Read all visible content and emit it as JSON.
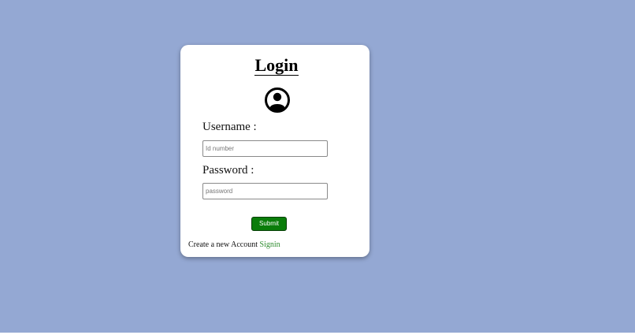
{
  "login": {
    "title": "Login",
    "avatar_icon": "user-circle-icon",
    "username_label": "Username :",
    "username_placeholder": "Id number",
    "username_value": "",
    "password_label": "Password :",
    "password_placeholder": "password",
    "password_value": "",
    "submit_label": "Submit",
    "footer_text": "Create a new Account",
    "signin_link": "Signin"
  },
  "colors": {
    "page_background": "#94a8d3",
    "card_background": "#ffffff",
    "submit_background": "#0a7d0a",
    "link_color": "#2e8b2e"
  }
}
